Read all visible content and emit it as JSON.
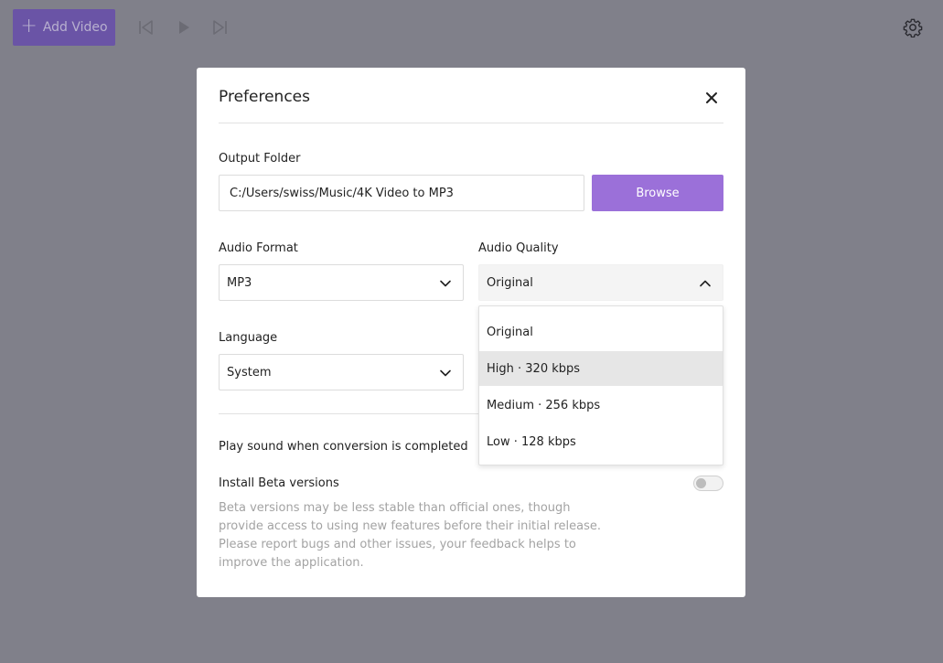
{
  "toolbar": {
    "add_video_label": "Add Video",
    "icons": [
      "skip-back-icon",
      "play-icon",
      "skip-forward-icon",
      "gear-icon"
    ]
  },
  "modal": {
    "title": "Preferences",
    "output_folder": {
      "label": "Output Folder",
      "path": "C:/Users/swiss/Music/4K Video to MP3",
      "browse_label": "Browse"
    },
    "audio_format": {
      "label": "Audio Format",
      "value": "MP3"
    },
    "audio_quality": {
      "label": "Audio Quality",
      "value": "Original",
      "options": [
        "Original",
        "High · 320 kbps",
        "Medium · 256 kbps",
        "Low · 128 kbps"
      ],
      "highlighted_option": "High · 320 kbps"
    },
    "language": {
      "label": "Language",
      "value": "System"
    },
    "play_sound_label": "Play sound when conversion is completed",
    "beta": {
      "label": "Install Beta versions",
      "description": "Beta versions may be less stable than official ones, though provide access to using new features before their initial release. Please report bugs and other issues, your feedback helps to improve the application.",
      "enabled": false
    }
  },
  "colors": {
    "accent": "#9b70d9",
    "overlay": "#80808a",
    "muted_text": "#a3a3a3"
  }
}
